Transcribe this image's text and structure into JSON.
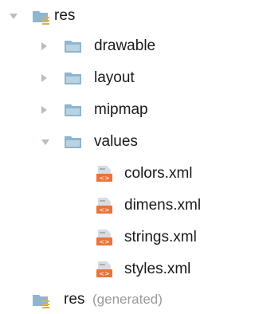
{
  "tree": {
    "res": {
      "label": "res",
      "expanded": true
    },
    "drawable": {
      "label": "drawable",
      "expanded": false
    },
    "layout": {
      "label": "layout",
      "expanded": false
    },
    "mipmap": {
      "label": "mipmap",
      "expanded": false
    },
    "values": {
      "label": "values",
      "expanded": true
    },
    "files": [
      {
        "label": "colors.xml"
      },
      {
        "label": "dimens.xml"
      },
      {
        "label": "strings.xml"
      },
      {
        "label": "styles.xml"
      }
    ],
    "res_generated": {
      "label": "res",
      "suffix": "(generated)"
    }
  },
  "colors": {
    "folder": "#8fb6cf",
    "folder_light": "#b9d3e3",
    "xml_badge": "#e8743b",
    "res_bars": "#e0b043",
    "arrow": "#b8bec4"
  },
  "icons": {
    "collapsed": "chevron-right-icon",
    "expanded": "chevron-down-icon",
    "resource_folder": "resource-folder-icon",
    "folder": "folder-icon",
    "xml_file": "xml-file-icon"
  }
}
